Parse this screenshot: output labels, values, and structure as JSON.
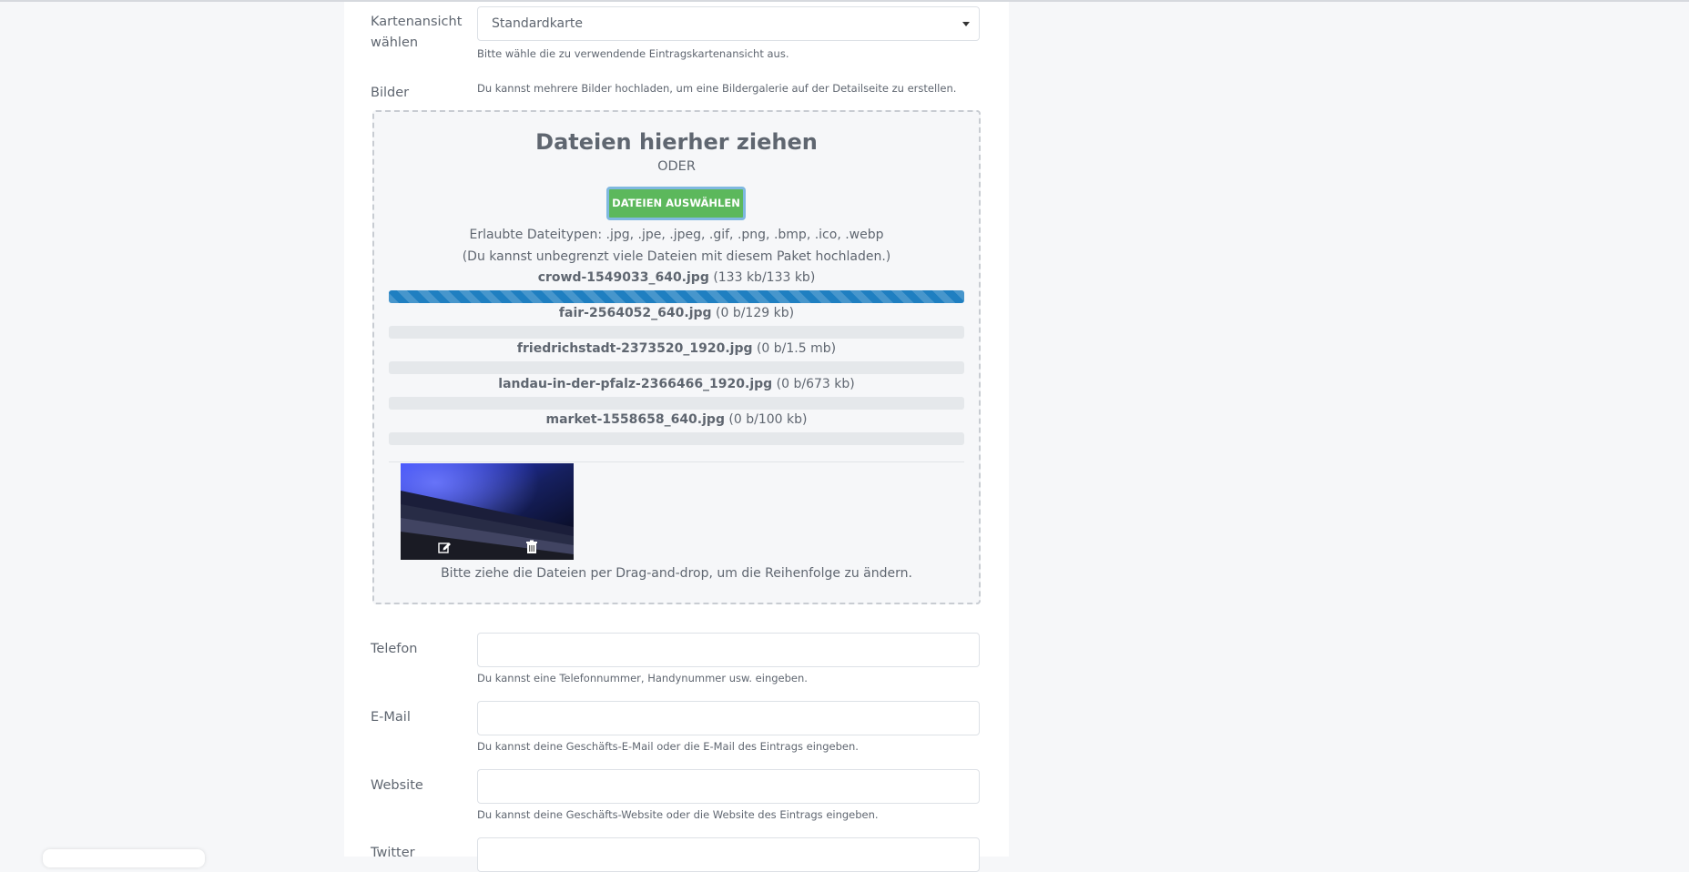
{
  "map_view": {
    "label": "Kartenansicht wählen",
    "label_line1": "Kartenansicht",
    "label_line2": "wählen",
    "selected": "Standardkarte",
    "help": "Bitte wähle die zu verwendende Eintragskartenansicht aus."
  },
  "images": {
    "label": "Bilder",
    "help": "Du kannst mehrere Bilder hochladen, um eine Bildergalerie auf der Detailseite zu erstellen.",
    "dropzone": {
      "title": "Dateien hierher ziehen",
      "or": "ODER",
      "button": "DATEIEN AUSWÄHLEN",
      "allowed": "Erlaubte Dateitypen: .jpg, .jpe, .jpeg, .gif, .png, .bmp, .ico, .webp",
      "limit": "(Du kannst unbegrenzt viele Dateien mit diesem Paket hochladen.)",
      "files": [
        {
          "name": "crowd-1549033_640.jpg",
          "size": "(133 kb/133 kb)",
          "progress": 1.0
        },
        {
          "name": "fair-2564052_640.jpg",
          "size": "(0 b/129 kb)",
          "progress": 0.0
        },
        {
          "name": "friedrichstadt-2373520_1920.jpg",
          "size": "(0 b/1.5 mb)",
          "progress": 0.0
        },
        {
          "name": "landau-in-der-pfalz-2366466_1920.jpg",
          "size": "(0 b/673 kb)",
          "progress": 0.0
        },
        {
          "name": "market-1558658_640.jpg",
          "size": "(0 b/100 kb)",
          "progress": 0.0
        }
      ],
      "thumbnail_icons": [
        "edit-icon",
        "trash-icon"
      ],
      "hint": "Bitte ziehe die Dateien per Drag-and-drop, um die Reihenfolge zu ändern."
    }
  },
  "phone": {
    "label": "Telefon",
    "value": "",
    "help": "Du kannst eine Telefonnummer, Handynummer usw. eingeben."
  },
  "email": {
    "label": "E-Mail",
    "value": "",
    "help": "Du kannst deine Geschäfts-E-Mail oder die E-Mail des Eintrags eingeben."
  },
  "website": {
    "label": "Website",
    "value": "",
    "help": "Du kannst deine Geschäfts-Website oder die Website des Eintrags eingeben."
  },
  "twitter": {
    "label": "Twitter",
    "value": ""
  },
  "colors": {
    "accent_button": "#5cb85c",
    "progress": "#1f7fc1",
    "page_bg": "#f6f7f9"
  }
}
